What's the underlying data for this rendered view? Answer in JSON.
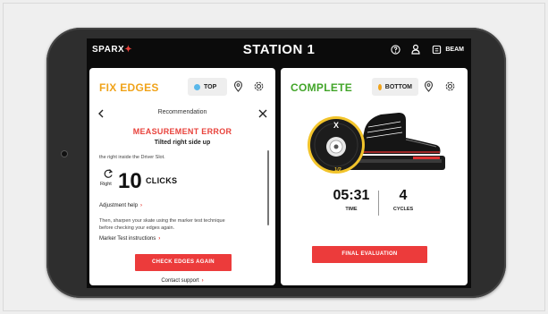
{
  "header": {
    "brand": "SPARX",
    "station_title": "STATION 1",
    "help_icon": "help-circle-icon",
    "user_icon": "user-icon",
    "beam_icon": "beam-icon",
    "beam_label": "BEAM"
  },
  "left_panel": {
    "title": "FIX EDGES",
    "position_label": "TOP",
    "position_color": "#5ab8ea",
    "recommendation": {
      "heading": "Recommendation",
      "error_title": "MEASUREMENT ERROR",
      "error_subtitle": "Tilted right side up",
      "hint": "the right inside the Driver Slot.",
      "rotate_direction": "Right",
      "clicks_count": "10",
      "clicks_word": "CLICKS",
      "adjustment_help": "Adjustment help",
      "sharpen_text": "Then, sharpen your skate using the marker test technique before checking your edges again.",
      "marker_instructions": "Marker Test instructions",
      "check_button": "CHECK EDGES AGAIN",
      "contact_support": "Contact support"
    }
  },
  "right_panel": {
    "title": "COMPLETE",
    "position_label": "BOTTOM",
    "position_color": "#f0a31a",
    "wheel_fraction": "1/2",
    "time_value": "05:31",
    "time_label": "TIME",
    "cycles_value": "4",
    "cycles_label": "CYCLES",
    "final_button": "FINAL EVALUATION"
  },
  "colors": {
    "accent_red": "#ec3b3b",
    "fix_edges_orange": "#f0a31a",
    "complete_green": "#42a529"
  }
}
